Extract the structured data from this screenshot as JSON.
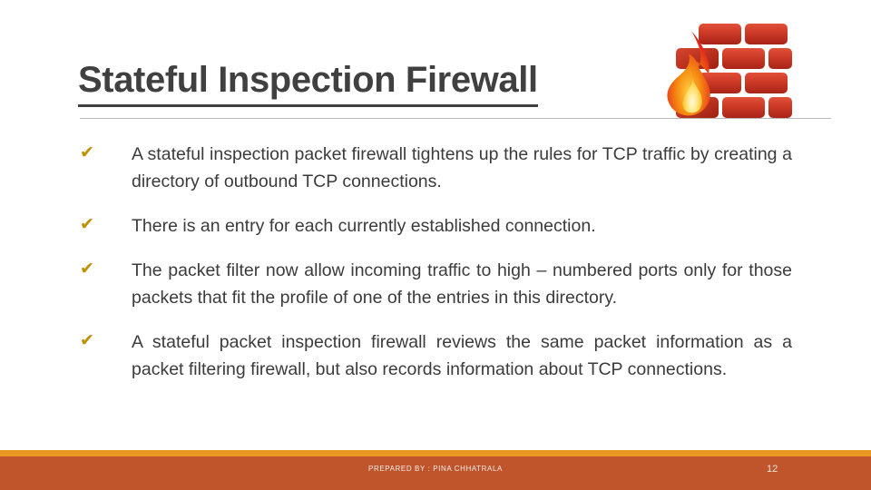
{
  "slide": {
    "title": "Stateful Inspection Firewall",
    "page_number": "12",
    "footer_credit": "PREPARED BY : PINA CHHATRALA",
    "icon_name": "firewall-brick-flame-icon"
  },
  "colors": {
    "title_text": "#404040",
    "body_text": "#3b3b3b",
    "bullet_check": "#bf9000",
    "footer_bar": "#c0552c",
    "footer_accent": "#e8981e",
    "brick_red": "#c0392b",
    "flame_orange": "#f07820",
    "rule_gray": "#b8b8b8"
  },
  "bullets": [
    {
      "marker": "✔",
      "text": "A stateful inspection packet firewall tightens up the rules for TCP traffic by creating a directory of outbound TCP connections."
    },
    {
      "marker": "✔",
      "text": "There is an entry for each currently established connection."
    },
    {
      "marker": "✔",
      "text": "The packet filter now allow incoming traffic to high – numbered ports only for those packets that fit the profile of one of the entries in this directory."
    },
    {
      "marker": "✔",
      "text": "A stateful packet inspection firewall reviews the same packet information as a packet filtering firewall, but also records information about TCP connections."
    }
  ]
}
